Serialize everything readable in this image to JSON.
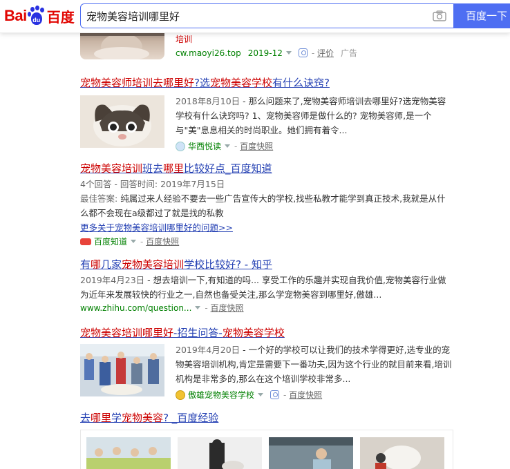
{
  "header": {
    "logo_bai": "Bai",
    "logo_du": "du",
    "logo_zh": "百度",
    "search_value": "宠物美容培训哪里好",
    "search_button": "百度一下",
    "camera_icon": "camera-icon"
  },
  "top_result": {
    "desc_tail": "培训",
    "url": "cw.maoyi26.top",
    "date": "2019-12",
    "review": "评价",
    "ad": "广告"
  },
  "results": [
    {
      "title_parts": [
        "宠物美容师培训",
        "去哪里好",
        "?选",
        "宠物美容学校",
        "有什么诀窍?"
      ],
      "date": "2018年8月10日",
      "text": "那么问题来了,宠物美容师培训去哪里好?选宠物美容学校有什么诀窍吗? 1、宠物美容师是做什么的? 宠物美容师,是一个与\"美\"息息相关的时尚职业。她们拥有着令...",
      "source": "华西悦读",
      "snapshot": "百度快照"
    },
    {
      "title_parts": [
        "宠物美容培训",
        "班去",
        "哪里",
        "比较好点_百度知道"
      ],
      "meta": "4个回答 - 回答时间: 2019年7月15日",
      "best_answer_label": "最佳答案:",
      "best_answer": "纯属过来人经验不要去一些广告宣传大的学校,找些私教才能学到真正技术,我就是从什么都不会现在a级都过了就是找的私教",
      "more_link": "更多关于宠物美容培训哪里好的问题>>",
      "source": "百度知道",
      "snapshot": "百度快照"
    },
    {
      "title_parts": [
        "有",
        "哪",
        "几家",
        "宠物美容培训",
        "学校比较好? - 知乎"
      ],
      "date": "2019年4月23日",
      "text": "想去培训一下,有知道的吗... 享受工作的乐趣并实现自我价值,宠物美容行业做为近年来发展较快的行业之一,自然也备受关注,那么学宠物美容到哪里好,傲雄...",
      "url": "www.zhihu.com/question...",
      "snapshot": "百度快照"
    },
    {
      "title_parts": [
        "宠物美容培训哪里好",
        "-招生问答-",
        "宠物美容学校"
      ],
      "date": "2019年4月20日",
      "text": "一个好的学校可以让我们的技术学得更好,选专业的宠物美容培训机构,肯定是需要下一番功夫,因为这个行业的就目前来看,培训机构是非常多的,那么在这个培训学校非常多...",
      "source": "傲雄宠物美容学校",
      "snapshot": "百度快照"
    },
    {
      "title_parts": [
        "去",
        "哪里",
        "学",
        "宠物美容",
        "? _百度经验"
      ]
    }
  ],
  "colors": {
    "link": "#2440b3",
    "highlight": "#c00000",
    "url_green": "#008000",
    "brand_red": "#e10602",
    "brand_blue": "#2932e1",
    "button_blue": "#4e6ef2"
  }
}
